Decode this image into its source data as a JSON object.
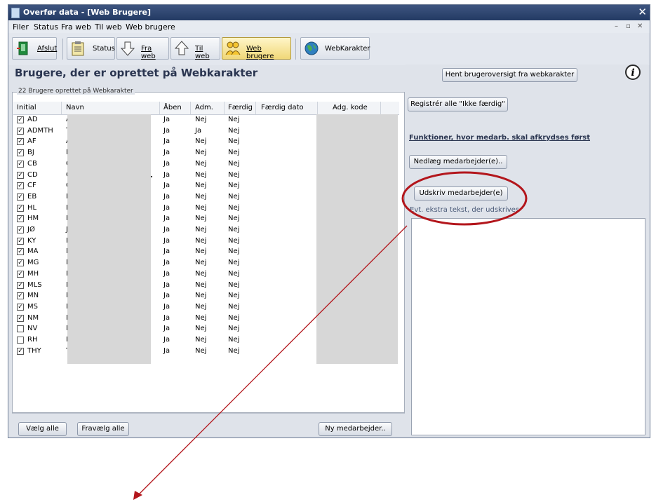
{
  "window": {
    "title": "Overfør data - [Web Brugere]",
    "close_glyph": "✕",
    "mdi_minimize": "–",
    "mdi_restore": "▫",
    "mdi_close": "✕"
  },
  "menu": [
    "Filer",
    "Status",
    "Fra web",
    "Til web",
    "Web brugere"
  ],
  "toolbar": {
    "afslut": "Afslut",
    "status": "Status",
    "fra_web": "Fra web",
    "til_web": "Til web",
    "web_brugere": "Web brugere",
    "webkarakter": "WebKarakter"
  },
  "heading": "Brugere, der er oprettet på Webkarakter",
  "groupbox_title": "22 Brugere oprettet på Webkarakter",
  "table": {
    "columns": [
      "Initial",
      "Navn",
      "Åben",
      "Adm.",
      "Færdig",
      "Færdig dato",
      "Adg. kode"
    ],
    "rows": [
      {
        "checked": true,
        "initial": "AD",
        "navn": "A",
        "aaben": "Ja",
        "adm": "Nej",
        "faerdig": "Nej"
      },
      {
        "checked": true,
        "initial": "ADMTH",
        "navn": "T",
        "aaben": "Ja",
        "adm": "Ja",
        "faerdig": "Nej"
      },
      {
        "checked": true,
        "initial": "AF",
        "navn": "A",
        "aaben": "Ja",
        "adm": "Nej",
        "faerdig": "Nej"
      },
      {
        "checked": true,
        "initial": "BJ",
        "navn": "B",
        "aaben": "Ja",
        "adm": "Nej",
        "faerdig": "Nej"
      },
      {
        "checked": true,
        "initial": "CB",
        "navn": "C",
        "aaben": "Ja",
        "adm": "Nej",
        "faerdig": "Nej"
      },
      {
        "checked": true,
        "initial": "CD",
        "navn": "C",
        "aaben": "Ja",
        "adm": "Nej",
        "faerdig": "Nej"
      },
      {
        "checked": true,
        "initial": "CF",
        "navn": "C",
        "aaben": "Ja",
        "adm": "Nej",
        "faerdig": "Nej"
      },
      {
        "checked": true,
        "initial": "EB",
        "navn": "E",
        "aaben": "Ja",
        "adm": "Nej",
        "faerdig": "Nej"
      },
      {
        "checked": true,
        "initial": "HL",
        "navn": "H",
        "aaben": "Ja",
        "adm": "Nej",
        "faerdig": "Nej"
      },
      {
        "checked": true,
        "initial": "HM",
        "navn": "H",
        "aaben": "Ja",
        "adm": "Nej",
        "faerdig": "Nej"
      },
      {
        "checked": true,
        "initial": "JØ",
        "navn": "J",
        "aaben": "Ja",
        "adm": "Nej",
        "faerdig": "Nej"
      },
      {
        "checked": true,
        "initial": "KY",
        "navn": "B",
        "aaben": "Ja",
        "adm": "Nej",
        "faerdig": "Nej"
      },
      {
        "checked": true,
        "initial": "MA",
        "navn": "M",
        "aaben": "Ja",
        "adm": "Nej",
        "faerdig": "Nej"
      },
      {
        "checked": true,
        "initial": "MG",
        "navn": "M",
        "aaben": "Ja",
        "adm": "Nej",
        "faerdig": "Nej"
      },
      {
        "checked": true,
        "initial": "MH",
        "navn": "M",
        "aaben": "Ja",
        "adm": "Nej",
        "faerdig": "Nej"
      },
      {
        "checked": true,
        "initial": "MLS",
        "navn": "M",
        "aaben": "Ja",
        "adm": "Nej",
        "faerdig": "Nej"
      },
      {
        "checked": true,
        "initial": "MN",
        "navn": "M",
        "aaben": "Ja",
        "adm": "Nej",
        "faerdig": "Nej"
      },
      {
        "checked": true,
        "initial": "MS",
        "navn": "M",
        "aaben": "Ja",
        "adm": "Nej",
        "faerdig": "Nej"
      },
      {
        "checked": true,
        "initial": "NM",
        "navn": "N",
        "aaben": "Ja",
        "adm": "Nej",
        "faerdig": "Nej"
      },
      {
        "checked": false,
        "initial": "NV",
        "navn": "N",
        "aaben": "Ja",
        "adm": "Nej",
        "faerdig": "Nej"
      },
      {
        "checked": false,
        "initial": "RH",
        "navn": "R",
        "aaben": "Ja",
        "adm": "Nej",
        "faerdig": "Nej"
      },
      {
        "checked": true,
        "initial": "THY",
        "navn": "T",
        "aaben": "Ja",
        "adm": "Nej",
        "faerdig": "Nej"
      }
    ]
  },
  "bottom_buttons": {
    "vaelg_alle": "Vælg alle",
    "fravaelg_alle": "Fravælg alle",
    "ny_medarbejder": "Ny medarbejder.."
  },
  "right_panel": {
    "hent_button": "Hent brugeroversigt fra webkarakter",
    "info_glyph": "i",
    "registrer_button": "Registrér alle \"Ikke færdig\"",
    "functions_label": "Funktioner, hvor medarb. skal afkrydses først",
    "nedlaeg_button": "Nedlæg medarbejder(e)..",
    "udskriv_button": "Udskriv medarbejder(e)",
    "extra_text_label": "Evt. ekstra tekst, der udskrives",
    "extra_text_value": ""
  },
  "colors": {
    "annotation": "#b3161c",
    "heading": "#2a3550"
  }
}
